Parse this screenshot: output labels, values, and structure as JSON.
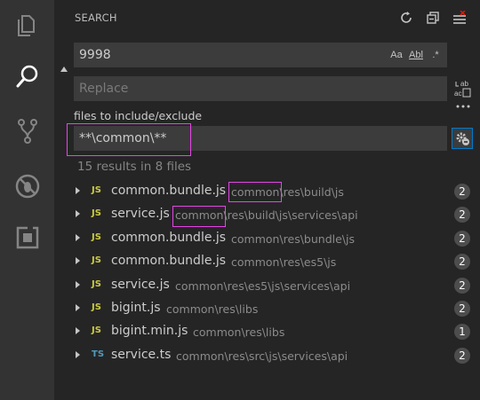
{
  "colors": {
    "activity_bar": "#333333",
    "sidebar_bg": "#252526",
    "input_bg": "#3c3c3c",
    "js_icon": "#cbcb41",
    "ts_icon": "#519aba",
    "highlight_box": "#e645e6",
    "focus_border": "#007acc"
  },
  "activity_bar": {
    "icons": [
      "files-icon",
      "search-icon",
      "source-control-icon",
      "debug-icon",
      "extensions-icon"
    ]
  },
  "header": {
    "title": "SEARCH",
    "actions": [
      "refresh-icon",
      "collapse-all-icon",
      "clear-results-icon"
    ]
  },
  "search": {
    "value": "9998",
    "options": [
      "Aa",
      "Abl",
      ".*"
    ]
  },
  "replace": {
    "placeholder": "Replace"
  },
  "include": {
    "label": "files to include/exclude",
    "value": "**\\common\\**"
  },
  "results_summary": "15 results in 8 files",
  "results": [
    {
      "type": "JS",
      "name": "common.bundle.js",
      "path": "common\\res\\build\\js",
      "count": "2"
    },
    {
      "type": "JS",
      "name": "service.js",
      "path": "common\\res\\build\\js\\services\\api",
      "count": "2"
    },
    {
      "type": "JS",
      "name": "common.bundle.js",
      "path": "common\\res\\bundle\\js",
      "count": "2"
    },
    {
      "type": "JS",
      "name": "common.bundle.js",
      "path": "common\\res\\es5\\js",
      "count": "2"
    },
    {
      "type": "JS",
      "name": "service.js",
      "path": "common\\res\\es5\\js\\services\\api",
      "count": "2"
    },
    {
      "type": "JS",
      "name": "bigint.js",
      "path": "common\\res\\libs",
      "count": "2"
    },
    {
      "type": "JS",
      "name": "bigint.min.js",
      "path": "common\\res\\libs",
      "count": "1"
    },
    {
      "type": "TS",
      "name": "service.ts",
      "path": "common\\res\\src\\js\\services\\api",
      "count": "2"
    }
  ]
}
